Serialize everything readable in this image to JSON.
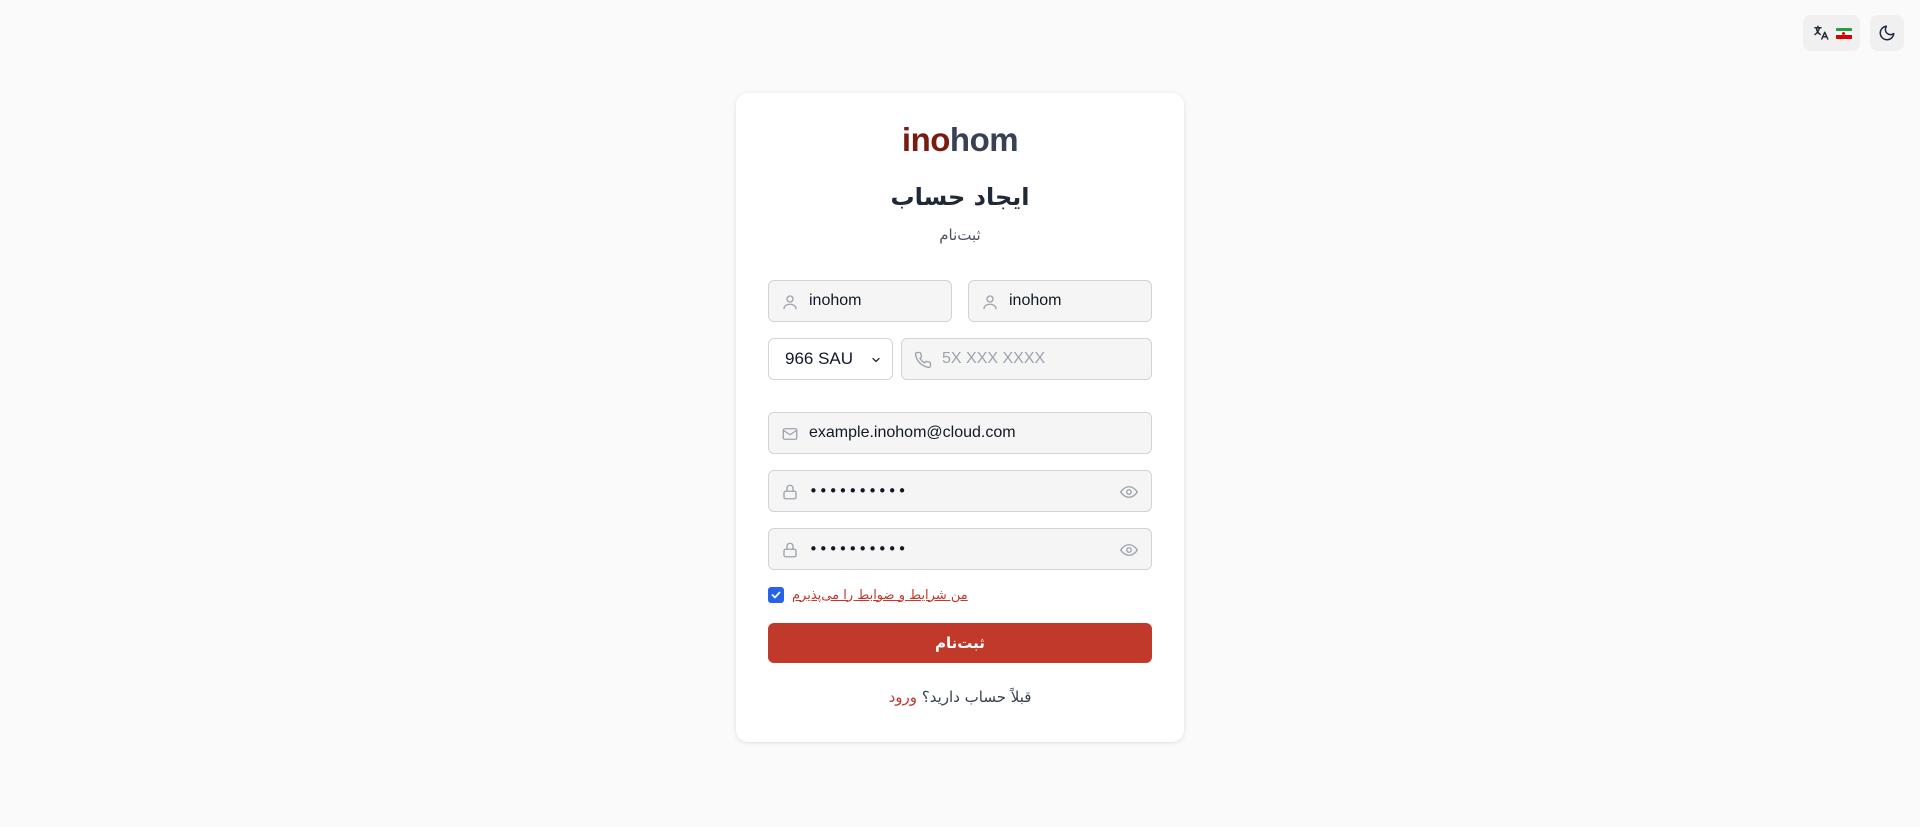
{
  "top_controls": {
    "language_icon": "translate-icon",
    "flag_icon": "iran-flag-icon",
    "theme_icon": "moon-icon",
    "flag_colors": [
      "#239f40",
      "#ffffff",
      "#da0000"
    ]
  },
  "brand": {
    "logo_part1": "ino",
    "logo_part2": "hom",
    "accent_color": "#c0392b",
    "logo_dark_color": "#7a1b10"
  },
  "form": {
    "title": "ایجاد حساب",
    "subtitle": "ثبت‌نام",
    "first_name_value": "inohom",
    "last_name_value": "inohom",
    "country_code_value": "966 SAU",
    "phone_placeholder": "5X XXX XXXX",
    "email_value": "example.inohom@cloud.com",
    "password_value": "••••••••••",
    "confirm_password_value": "••••••••••",
    "terms_label": "من شرایط و ضوابط را می‌پذیرم",
    "terms_checked": true,
    "submit_label": "ثبت‌نام",
    "login_prompt": "قبلاً حساب دارید؟",
    "login_link": "ورود"
  }
}
